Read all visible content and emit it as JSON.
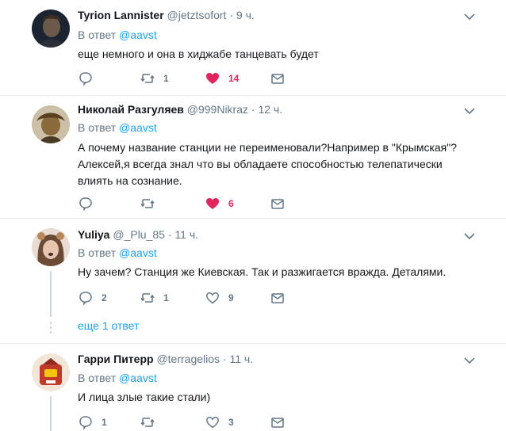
{
  "tweets": [
    {
      "name": "Tyrion Lannister",
      "handle": "@jetztsofort",
      "time": "· 9 ч.",
      "reply_prefix": "В ответ",
      "reply_mention": "@aavst",
      "text": "еще немного и она в хиджабе танцевать будет",
      "reply_count": "",
      "retweet_count": "1",
      "like_count": "14",
      "liked": true,
      "avatar_color": "#1b2430"
    },
    {
      "name": "Николай Разгуляев",
      "handle": "@999Nikraz",
      "time": "· 12 ч.",
      "reply_prefix": "В ответ",
      "reply_mention": "@aavst",
      "text": "А почему название станции не переименовали?Например в \"Крымская\"? Алексей,я всегда знал что вы обладаете способностью телепатически влиять на сознание.",
      "reply_count": "",
      "retweet_count": "",
      "like_count": "6",
      "liked": true,
      "avatar_color": "#8a6a3a"
    },
    {
      "name": "Yuliya",
      "handle": "@_Plu_85",
      "time": "· 11 ч.",
      "reply_prefix": "В ответ",
      "reply_mention": "@aavst",
      "text": "Ну зачем? Станция же Киевская. Так и разжигается вражда. Деталями.",
      "reply_count": "2",
      "retweet_count": "1",
      "like_count": "9",
      "liked": false,
      "avatar_color": "#d9b8a6"
    },
    {
      "name": "Гарри Питерр",
      "handle": "@terragelios",
      "time": "· 11 ч.",
      "reply_prefix": "В ответ",
      "reply_mention": "@aavst",
      "text": "И лица злые такие стали)",
      "reply_count": "1",
      "retweet_count": "",
      "like_count": "3",
      "liked": false,
      "avatar_color": "#c0392b"
    }
  ],
  "show_more": "еще 1 ответ",
  "colors": {
    "accent": "#1da1f2",
    "like": "#e0245e",
    "muted": "#657786",
    "divider": "#e6ecf0"
  }
}
